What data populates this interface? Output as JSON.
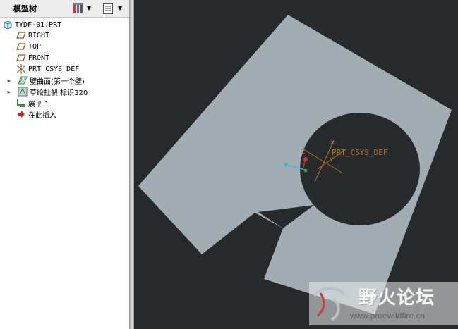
{
  "model_tree": {
    "title": "模型树",
    "items": [
      {
        "label": "TYDF-01.PRT",
        "icon": "part-icon",
        "expandable": false
      },
      {
        "label": "RIGHT",
        "icon": "datum-plane-icon",
        "expandable": false
      },
      {
        "label": "TOP",
        "icon": "datum-plane-icon",
        "expandable": false
      },
      {
        "label": "FRONT",
        "icon": "datum-plane-icon",
        "expandable": false
      },
      {
        "label": "PRT_CSYS_DEF",
        "icon": "coordinate-system-icon",
        "expandable": false
      },
      {
        "label": "壁曲面(第一个壁)",
        "icon": "sheetmetal-wall-icon",
        "expandable": true
      },
      {
        "label": "草绘扯裂 标识320",
        "icon": "sketch-rip-icon",
        "expandable": true
      },
      {
        "label": "展平 1",
        "icon": "unbend-icon",
        "expandable": false
      },
      {
        "label": "在此插入",
        "icon": "insert-here-arrow-icon",
        "expandable": false
      }
    ]
  },
  "viewport": {
    "csys_label": "PRT_CSYS_DEF",
    "axis_x": "X",
    "axis_y": "Y",
    "axis_z": "Z",
    "background_color": "#272a2b",
    "part_color": "#a1acb3"
  },
  "watermark": {
    "title": "野火论坛",
    "url": "www.proewildfire.cn"
  }
}
